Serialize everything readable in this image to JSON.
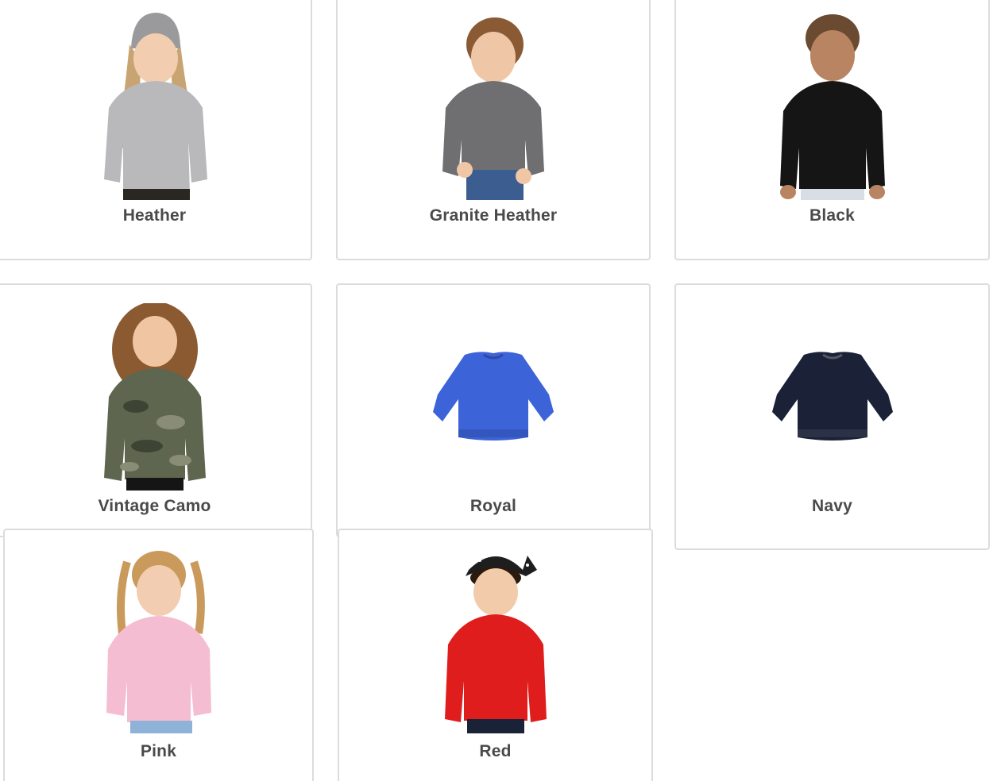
{
  "swatches": [
    {
      "name": "Heather",
      "color": "#b9b9bb",
      "kind": "child"
    },
    {
      "name": "Granite Heather",
      "color": "#6f6f72",
      "kind": "child"
    },
    {
      "name": "Black",
      "color": "#151515",
      "kind": "child"
    },
    {
      "name": "Vintage Camo",
      "color": "#5f6650",
      "kind": "child"
    },
    {
      "name": "Royal",
      "color": "#3c63d8",
      "kind": "shirt"
    },
    {
      "name": "Navy",
      "color": "#1b2136",
      "kind": "shirt"
    },
    {
      "name": "Pink",
      "color": "#f4bdd2",
      "kind": "child"
    },
    {
      "name": "Red",
      "color": "#e01d1d",
      "kind": "child"
    }
  ]
}
